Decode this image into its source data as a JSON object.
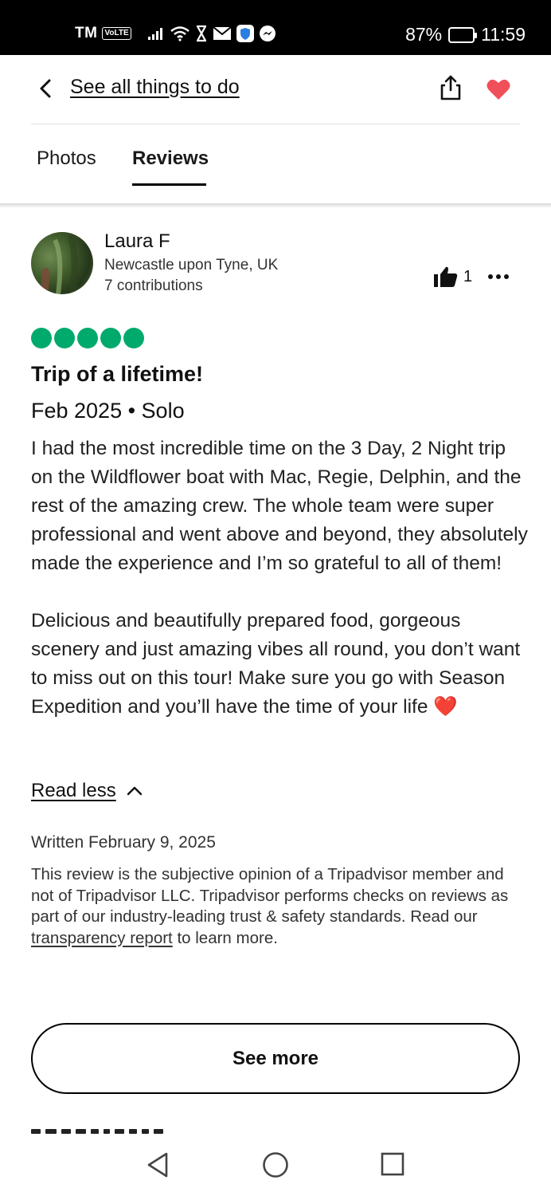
{
  "status_bar": {
    "carrier": "TM",
    "volte": "VoLTE",
    "battery_percent": "87%",
    "battery_level": 0.87,
    "time": "11:59",
    "icons": [
      "signal-icon",
      "wifi-icon",
      "hourglass-icon",
      "mail-icon",
      "shield-icon",
      "messenger-icon"
    ]
  },
  "header": {
    "back_label": "See all things to do",
    "icons": [
      "back-arrow-icon",
      "share-icon",
      "heart-icon"
    ],
    "heart_color": "#f0505a"
  },
  "tabs": [
    {
      "label": "Photos",
      "active": false
    },
    {
      "label": "Reviews",
      "active": true
    }
  ],
  "review": {
    "reviewer": {
      "name": "Laura F",
      "location": "Newcastle upon Tyne, UK",
      "contributions": "7 contributions"
    },
    "helpful_count": "1",
    "rating": 5,
    "rating_color": "#00aa6c",
    "title": "Trip of a lifetime!",
    "meta": "Feb 2025 • Solo",
    "paragraphs": [
      "I had the most incredible time on the 3 Day, 2 Night trip on the Wildflower boat with Mac, Regie, Delphin, and the rest of the amazing crew. The whole team were super professional and went above and beyond, they absolutely made the experience and I’m so grateful to all of them!",
      "Delicious and beautifully prepared food, gorgeous scenery and just amazing vibes all round, you don’t want to miss out on this tour! Make sure you go with Season Expedition and you’ll have the time of your life"
    ],
    "emoji": "❤️",
    "read_less_label": "Read less",
    "written_date": "Written February 9, 2025",
    "disclaimer_before": "This review is the subjective opinion of a Tripadvisor member and not of Tripadvisor LLC. Tripadvisor performs checks on reviews as part of our industry-leading trust & safety standards. Read our ",
    "disclaimer_link": "transparency report",
    "disclaimer_after": " to learn more."
  },
  "see_more_label": "See more",
  "system_nav": [
    "nav-back-icon",
    "nav-home-icon",
    "nav-recents-icon"
  ]
}
